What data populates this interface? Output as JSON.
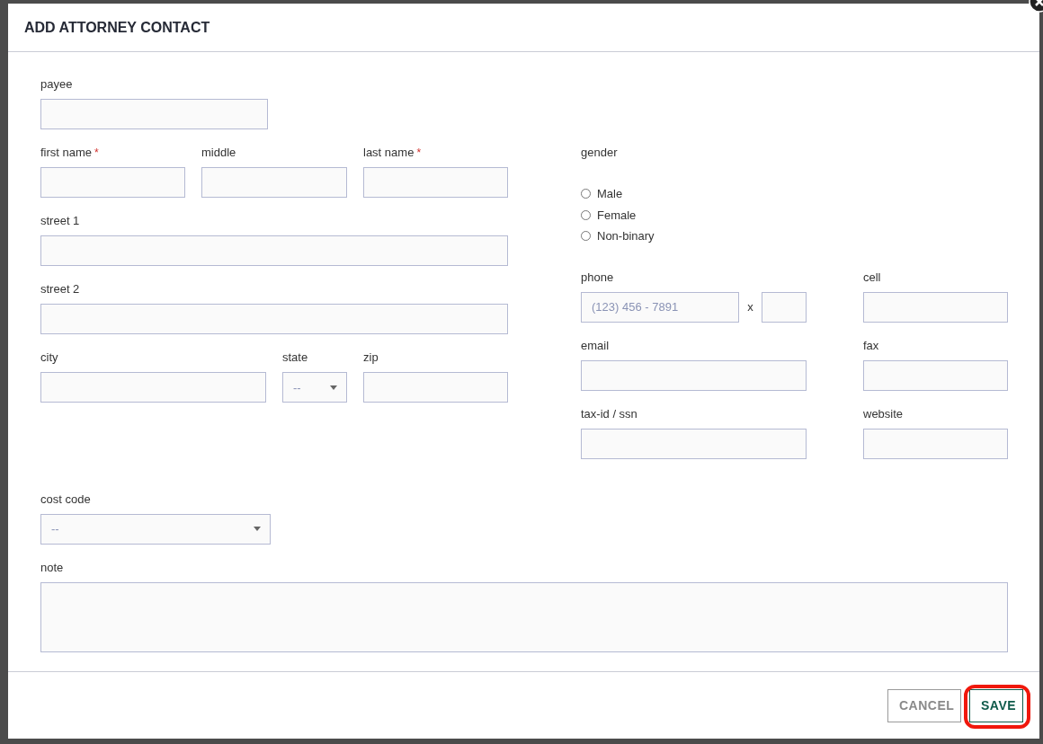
{
  "dialog": {
    "title": "ADD ATTORNEY CONTACT"
  },
  "required_mark": "*",
  "payee": {
    "label": "payee"
  },
  "name_fields": [
    {
      "label": "first name",
      "required": true
    },
    {
      "label": "middle",
      "required": false
    },
    {
      "label": "last name",
      "required": true
    }
  ],
  "street_1": {
    "label": "street 1"
  },
  "street_2": {
    "label": "street 2"
  },
  "city": {
    "label": "city"
  },
  "state": {
    "label": "state",
    "value": "--"
  },
  "zip": {
    "label": "zip"
  },
  "gender": {
    "label": "gender",
    "options": [
      {
        "label": "Male",
        "selected": false
      },
      {
        "label": "Female",
        "selected": false
      },
      {
        "label": "Non-binary",
        "selected": false
      }
    ]
  },
  "phone": {
    "label": "phone",
    "placeholder": "(123) 456 - 7891",
    "extension_separator": "x"
  },
  "cell": {
    "label": "cell"
  },
  "email": {
    "label": "email"
  },
  "fax": {
    "label": "fax"
  },
  "tax_id": {
    "label": "tax-id / ssn"
  },
  "website": {
    "label": "website"
  },
  "cost_code": {
    "label": "cost code",
    "value": "--"
  },
  "note": {
    "label": "note"
  },
  "buttons": [
    {
      "label": "CANCEL",
      "kind": "secondary",
      "highlighted": false
    },
    {
      "label": "SAVE",
      "kind": "primary",
      "highlighted": true
    }
  ]
}
